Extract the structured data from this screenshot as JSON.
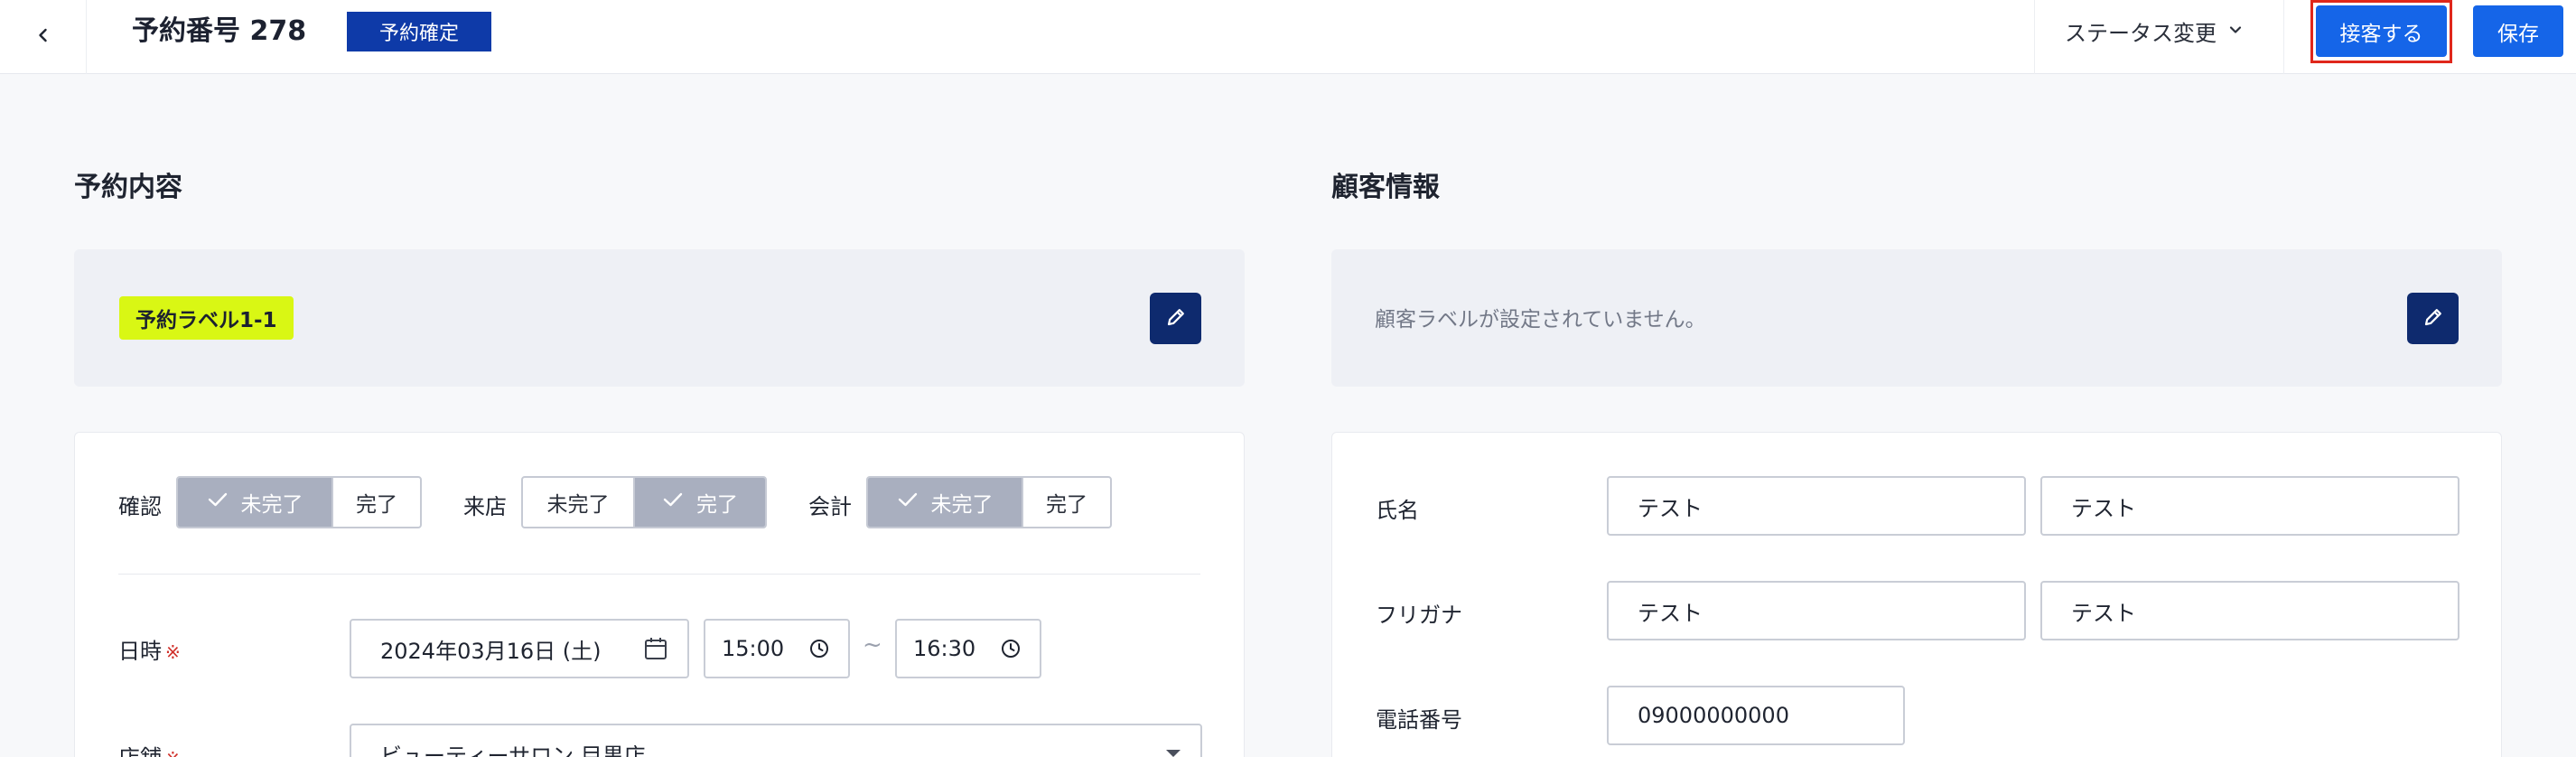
{
  "header": {
    "title": "予約番号 278",
    "status_badge": "予約確定",
    "status_change_label": "ステータス変更",
    "serve_button": "接客する",
    "save_button": "保存"
  },
  "reservation": {
    "section_title": "予約内容",
    "label_chip": "予約ラベル1-1",
    "toggles": [
      {
        "label": "確認",
        "options": [
          "未完了",
          "完了"
        ],
        "active": "未完了"
      },
      {
        "label": "来店",
        "options": [
          "未完了",
          "完了"
        ],
        "active": "完了"
      },
      {
        "label": "会計",
        "options": [
          "未完了",
          "完了"
        ],
        "active": "未完了"
      }
    ],
    "datetime_label": "日時",
    "required_mark": "※",
    "date_value": "2024年03月16日 (土)",
    "start_time": "15:00",
    "tilde": "~",
    "end_time": "16:30",
    "store_label": "店舗",
    "store_value": "ビューティーサロン 目黒店"
  },
  "customer": {
    "section_title": "顧客情報",
    "empty_label_text": "顧客ラベルが設定されていません。",
    "name_label": "氏名",
    "last_name": "テスト",
    "first_name": "テスト",
    "kana_label": "フリガナ",
    "last_kana": "テスト",
    "first_kana": "テスト",
    "phone_label": "電話番号",
    "phone_value": "09000000000"
  },
  "icons": {
    "back": "chevron-left-icon",
    "dropdown": "chevron-down-icon",
    "edit": "pencil-icon",
    "calendar": "calendar-icon",
    "clock": "clock-icon",
    "check": "check-icon",
    "select_caret": "caret-down-icon"
  },
  "colors": {
    "badge": "#0e3aa8",
    "primary": "#1565e8",
    "highlight_frame": "#e0271b",
    "label_chip": "#d9f714",
    "edit_button": "#0e2a6e",
    "toggle_active": "#a9afbf"
  }
}
